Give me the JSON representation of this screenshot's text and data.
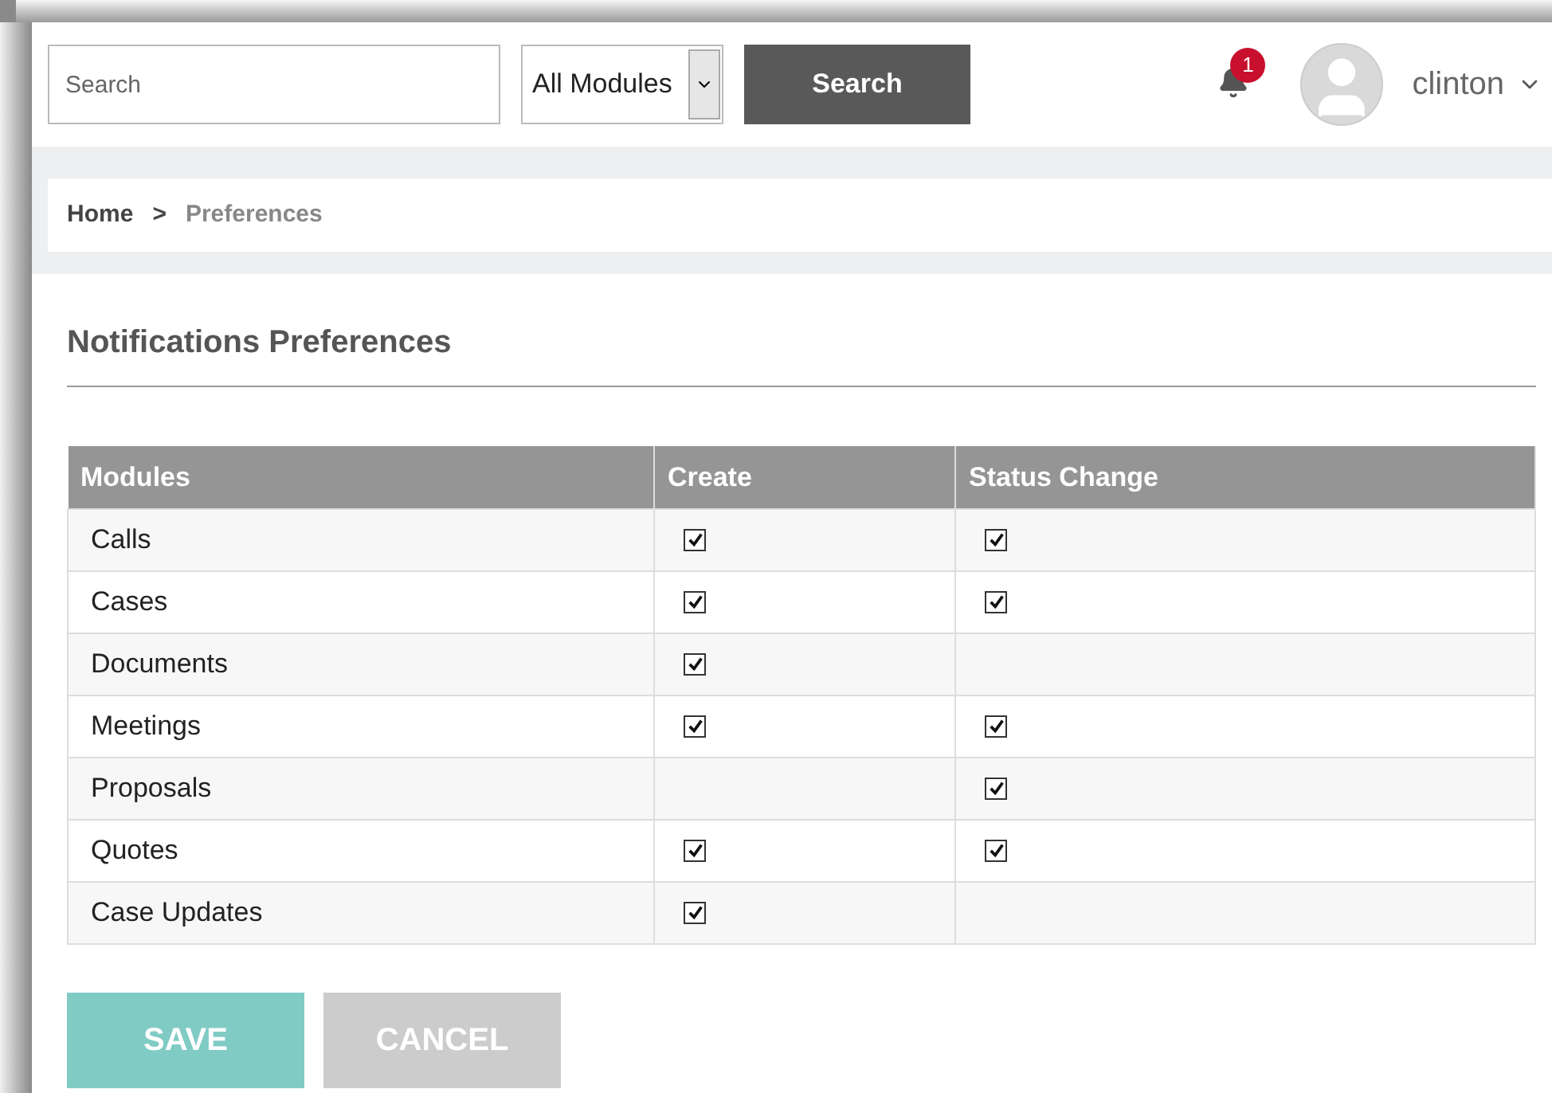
{
  "header": {
    "search": {
      "placeholder": "Search"
    },
    "module_select": {
      "value": "All Modules"
    },
    "search_button": "Search",
    "notifications": {
      "count": "1"
    },
    "user": {
      "name": "clinton"
    }
  },
  "breadcrumb": [
    {
      "label": "Home",
      "current": false
    },
    {
      "label": ">",
      "current": false
    },
    {
      "label": "Preferences",
      "current": true
    }
  ],
  "title": "Notifications Preferences",
  "table": {
    "columns": [
      "Modules",
      "Create",
      "Status Change"
    ],
    "rows": [
      {
        "module": "Calls",
        "create": {
          "checked": true
        },
        "status_change": {
          "checked": true
        }
      },
      {
        "module": "Cases",
        "create": {
          "checked": true
        },
        "status_change": {
          "checked": true
        }
      },
      {
        "module": "Documents",
        "create": {
          "checked": true
        }
      },
      {
        "module": "Meetings",
        "create": {
          "checked": true
        },
        "status_change": {
          "checked": true
        }
      },
      {
        "module": "Proposals",
        "status_change": {
          "checked": true
        }
      },
      {
        "module": "Quotes",
        "create": {
          "checked": true
        },
        "status_change": {
          "checked": true
        }
      },
      {
        "module": "Case Updates",
        "create": {
          "checked": true
        }
      }
    ]
  },
  "buttons": [
    {
      "label": "SAVE",
      "kind": "primary"
    },
    {
      "label": "CANCEL",
      "kind": "secondary"
    }
  ]
}
